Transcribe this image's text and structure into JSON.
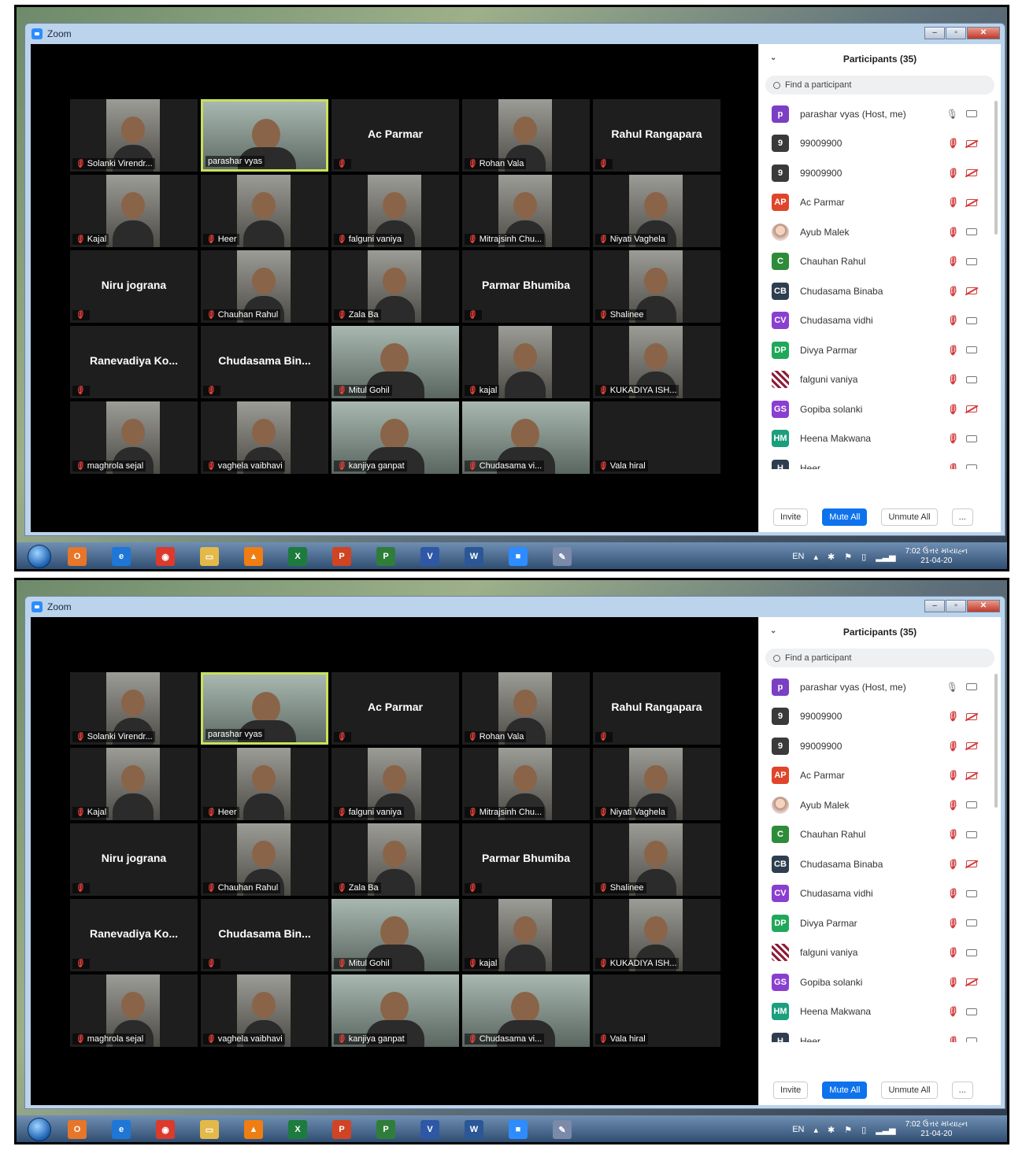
{
  "app": {
    "title": "Zoom",
    "window_controls": {
      "minimize": "–",
      "maximize": "▫",
      "close": "✕"
    }
  },
  "gallery": {
    "tiles": [
      {
        "name": "Solanki Virendr...",
        "video": true
      },
      {
        "name": "parashar vyas",
        "video": true,
        "wide": true,
        "active": true
      },
      {
        "name": "",
        "center": "Ac Parmar",
        "video": false
      },
      {
        "name": "Rohan Vala",
        "video": true
      },
      {
        "name": "",
        "center": "Rahul Rangapara",
        "video": false
      },
      {
        "name": "Kajal",
        "video": true
      },
      {
        "name": "Heer",
        "video": true
      },
      {
        "name": "falguni vaniya",
        "video": true
      },
      {
        "name": "Mitrajsinh Chu...",
        "video": true
      },
      {
        "name": "Niyati Vaghela",
        "video": true
      },
      {
        "name": "",
        "center": "Niru jograna",
        "video": false
      },
      {
        "name": "Chauhan Rahul",
        "video": true
      },
      {
        "name": "Zala Ba",
        "video": true
      },
      {
        "name": "",
        "center": "Parmar Bhumiba",
        "video": false
      },
      {
        "name": "Shalinee",
        "video": true
      },
      {
        "name": "",
        "center": "Ranevadiya Ko...",
        "video": false
      },
      {
        "name": "",
        "center": "Chudasama Bin...",
        "video": false
      },
      {
        "name": "Mitul Gohil",
        "video": true,
        "wide": true
      },
      {
        "name": "kajal",
        "video": true
      },
      {
        "name": "KUKADIYA ISH...",
        "video": true
      },
      {
        "name": "maghrola sejal",
        "video": true
      },
      {
        "name": "vaghela vaibhavi",
        "video": true
      },
      {
        "name": "kanjiya ganpat",
        "video": true,
        "wide": true
      },
      {
        "name": "Chudasama vi...",
        "video": true,
        "wide": true
      },
      {
        "name": "Vala hiral",
        "video": false
      }
    ]
  },
  "participants": {
    "title": "Participants (35)",
    "search_placeholder": "Find a participant",
    "list": [
      {
        "initials": "p",
        "color": "#7b3fc4",
        "name": "parashar vyas (Host, me)",
        "mic": "on",
        "cam": "on"
      },
      {
        "initials": "9",
        "color": "#3a3a3a",
        "name": "99009900",
        "mic": "off",
        "cam": "off"
      },
      {
        "initials": "9",
        "color": "#3a3a3a",
        "name": "99009900",
        "mic": "off",
        "cam": "off"
      },
      {
        "initials": "AP",
        "color": "#e0452b",
        "name": "Ac Parmar",
        "mic": "off",
        "cam": "off"
      },
      {
        "initials": "",
        "avatar": "photo",
        "name": "Ayub Malek",
        "mic": "off",
        "cam": "on"
      },
      {
        "initials": "C",
        "color": "#2e8b3a",
        "name": "Chauhan Rahul",
        "mic": "off",
        "cam": "on"
      },
      {
        "initials": "CB",
        "color": "#2f3e4f",
        "name": "Chudasama Binaba",
        "mic": "off",
        "cam": "off"
      },
      {
        "initials": "CV",
        "color": "#8a3fd1",
        "name": "Chudasama vidhi",
        "mic": "off",
        "cam": "on"
      },
      {
        "initials": "DP",
        "color": "#1fa85a",
        "name": "Divya Parmar",
        "mic": "off",
        "cam": "on"
      },
      {
        "initials": "",
        "avatar": "pattern",
        "name": "falguni vaniya",
        "mic": "off",
        "cam": "on"
      },
      {
        "initials": "GS",
        "color": "#8a3fd1",
        "name": "Gopiba solanki",
        "mic": "off",
        "cam": "off"
      },
      {
        "initials": "HM",
        "color": "#1b9f7c",
        "name": "Heena Makwana",
        "mic": "off",
        "cam": "on"
      },
      {
        "initials": "H",
        "color": "#2f3e4f",
        "name": "Heer",
        "mic": "off",
        "cam": "on"
      }
    ],
    "buttons": {
      "invite": "Invite",
      "mute_all": "Mute All",
      "unmute_all": "Unmute All",
      "more": "..."
    }
  },
  "taskbar": {
    "apps": [
      {
        "icon": "outlook-icon",
        "glyph": "O",
        "color": "#e7752a"
      },
      {
        "icon": "internet-explorer-icon",
        "glyph": "e",
        "color": "#1e77d6"
      },
      {
        "icon": "chrome-icon",
        "glyph": "◉",
        "color": "#db3a2c"
      },
      {
        "icon": "file-explorer-icon",
        "glyph": "▭",
        "color": "#e3b94a"
      },
      {
        "icon": "vlc-icon",
        "glyph": "▲",
        "color": "#f07d12"
      },
      {
        "icon": "excel-icon",
        "glyph": "X",
        "color": "#1e7b3e"
      },
      {
        "icon": "powerpoint-icon",
        "glyph": "P",
        "color": "#d04423"
      },
      {
        "icon": "project-icon",
        "glyph": "P",
        "color": "#2f7d3a"
      },
      {
        "icon": "visio-icon",
        "glyph": "V",
        "color": "#2e58a6"
      },
      {
        "icon": "word-icon",
        "glyph": "W",
        "color": "#2b5797"
      },
      {
        "icon": "zoom-icon",
        "glyph": "■",
        "color": "#2d8cff"
      },
      {
        "icon": "paint-icon",
        "glyph": "✎",
        "color": "#7a8aa8"
      }
    ],
    "lang": "EN",
    "time": "7:02 ઉત્તર મધ્યાહ્ન",
    "date": "21-04-20"
  }
}
